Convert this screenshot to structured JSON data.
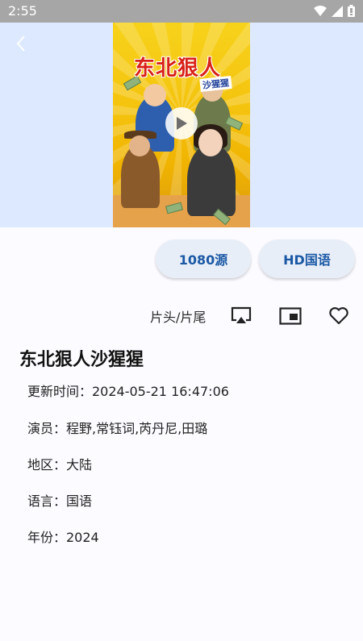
{
  "status_bar": {
    "time": "2:55"
  },
  "poster": {
    "title": "东北狠人",
    "subtitle": "沙猩猩"
  },
  "sources": [
    "1080源",
    "HD国语"
  ],
  "toolbar": {
    "skip_label": "片头/片尾"
  },
  "details": {
    "title": "东北狠人沙猩猩",
    "update_time": "更新时间：2024-05-21 16:47:06",
    "cast": "演员：程野,常钰词,芮丹尼,田璐",
    "region": "地区：大陆",
    "language": "语言：国语",
    "year": "年份：2024"
  },
  "colors": {
    "accent": "#1b59a5",
    "hero_bg": "#dce9ff",
    "status_bg": "#a6a6a6"
  }
}
